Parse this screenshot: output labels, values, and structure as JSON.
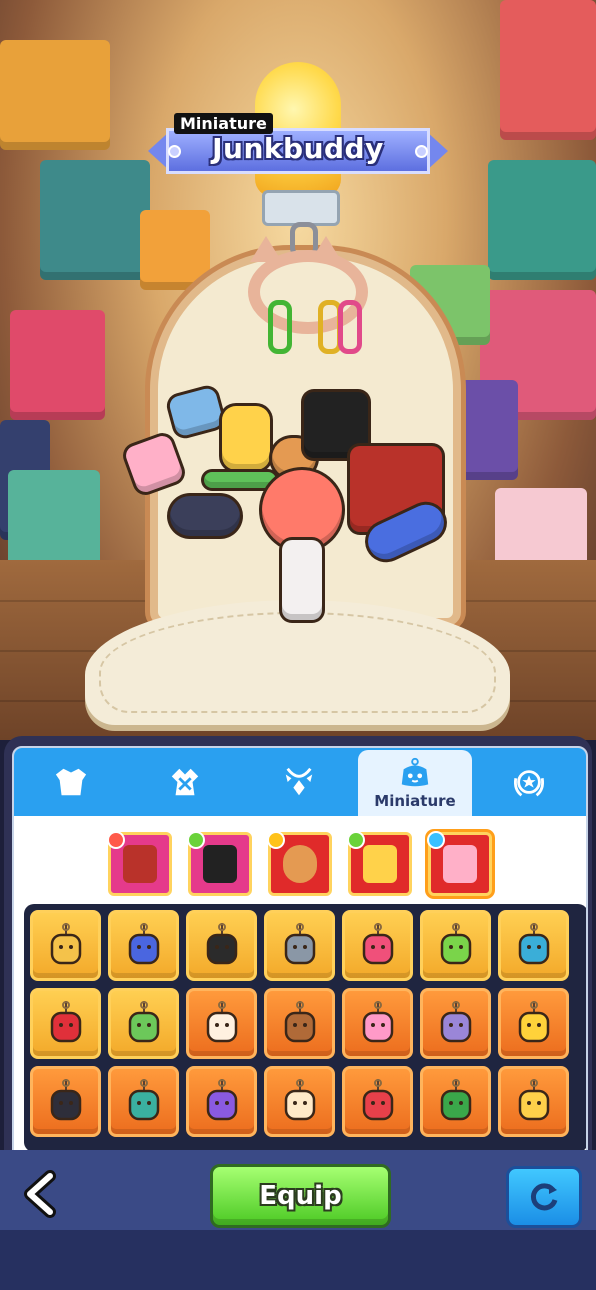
{
  "item": {
    "category_tag": "Miniature",
    "name": "Junkbuddy"
  },
  "tabs": [
    {
      "icon": "armor-icon",
      "label": "",
      "active": false
    },
    {
      "icon": "outfit-icon",
      "label": "",
      "active": false
    },
    {
      "icon": "necklace-icon",
      "label": "",
      "active": false
    },
    {
      "icon": "miniature-icon",
      "label": "Miniature",
      "active": true
    },
    {
      "icon": "emblem-icon",
      "label": "",
      "active": false
    }
  ],
  "equipped_slots": [
    {
      "icon": "treasure-chest-charm-icon",
      "gem_color": "#ff5a4a",
      "bg": "#e53a8b"
    },
    {
      "icon": "black-fist-charm-icon",
      "gem_color": "#6ad23a",
      "bg": "#e53a8b"
    },
    {
      "icon": "donut-bear-charm-icon",
      "gem_color": "#ffc21a",
      "bg": "#e02a2a"
    },
    {
      "icon": "chick-can-charm-icon",
      "gem_color": "#6ad23a",
      "bg": "#e02a2a"
    },
    {
      "icon": "letter-block-charm-icon",
      "gem_color": "#3ac0ff",
      "bg": "#e02a2a"
    }
  ],
  "inventory": [
    {
      "icon": "block-stack-charm-icon",
      "tier": "yellow"
    },
    {
      "icon": "blue-star-charm-icon",
      "tier": "yellow"
    },
    {
      "icon": "skull-charm-icon",
      "tier": "yellow"
    },
    {
      "icon": "gray-cat-charm-icon",
      "tier": "yellow"
    },
    {
      "icon": "heart-music-charm-icon",
      "tier": "yellow"
    },
    {
      "icon": "green-star-charm-icon",
      "tier": "yellow"
    },
    {
      "icon": "dino-charm-icon",
      "tier": "yellow"
    },
    {
      "icon": "pixel-heart-charm-icon",
      "tier": "yellow"
    },
    {
      "icon": "frog-charm-icon",
      "tier": "yellow"
    },
    {
      "icon": "calico-cat-charm-icon",
      "tier": "orange"
    },
    {
      "icon": "honey-bear-charm-icon",
      "tier": "orange"
    },
    {
      "icon": "flower-beads-charm-icon",
      "tier": "orange"
    },
    {
      "icon": "purple-rock-charm-icon",
      "tier": "orange"
    },
    {
      "icon": "sun-charm-icon",
      "tier": "orange"
    },
    {
      "icon": "game-controller-charm-icon",
      "tier": "orange"
    },
    {
      "icon": "arcade-charm-icon",
      "tier": "orange"
    },
    {
      "icon": "party-hat-charm-icon",
      "tier": "orange"
    },
    {
      "icon": "pow-charm-icon",
      "tier": "orange"
    },
    {
      "icon": "gumball-charm-icon",
      "tier": "orange"
    },
    {
      "icon": "clover-charm-icon",
      "tier": "orange"
    },
    {
      "icon": "cheese-bear-charm-icon",
      "tier": "orange"
    }
  ],
  "actions": {
    "equip_label": "Equip",
    "back_icon": "chevron-left-icon",
    "refresh_icon": "refresh-icon"
  },
  "colors": {
    "tab_bar": "#2aa0f0",
    "equip_button": "#4cc924",
    "refresh_button": "#1b8ee6",
    "panel": "#2f3155"
  }
}
